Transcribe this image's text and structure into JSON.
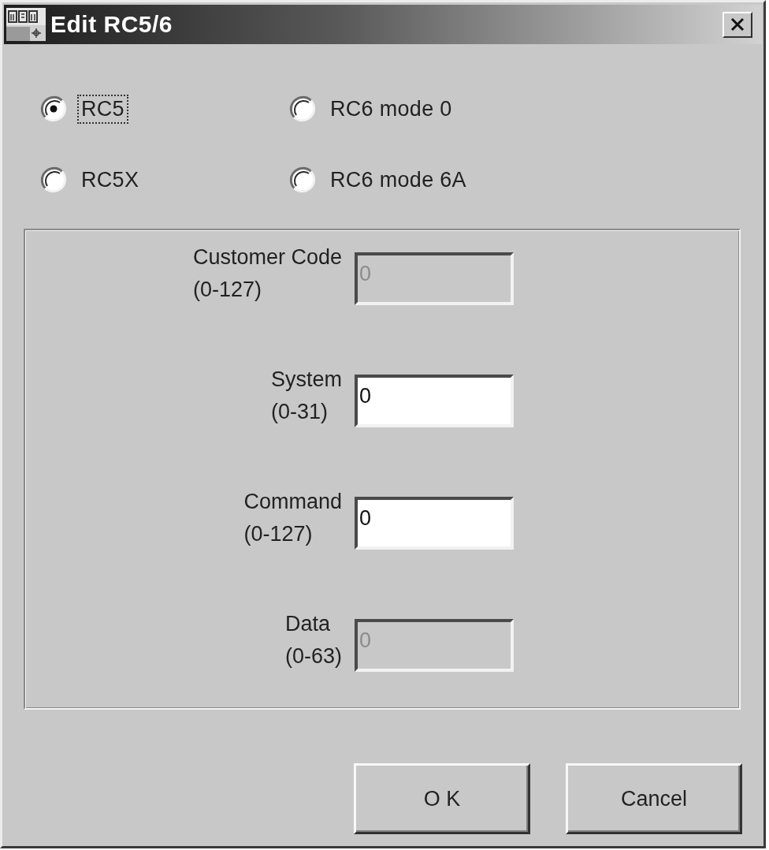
{
  "window": {
    "title": "Edit RC5/6"
  },
  "modes": [
    {
      "label": "RC5",
      "selected": true,
      "focused": true
    },
    {
      "label": "RC6 mode 0",
      "selected": false,
      "focused": false
    },
    {
      "label": "RC5X",
      "selected": false,
      "focused": false
    },
    {
      "label": "RC6 mode 6A",
      "selected": false,
      "focused": false
    }
  ],
  "fields": [
    {
      "label": "Customer Code",
      "range": "(0-127)",
      "value": "0",
      "disabled": true
    },
    {
      "label": "System",
      "range": "(0-31)",
      "value": "0",
      "disabled": false
    },
    {
      "label": "Command",
      "range": "(0-127)",
      "value": "0",
      "disabled": false
    },
    {
      "label": "Data",
      "range": "(0-63)",
      "value": "0",
      "disabled": true
    }
  ],
  "buttons": [
    {
      "label": "O K"
    },
    {
      "label": "Cancel"
    }
  ]
}
